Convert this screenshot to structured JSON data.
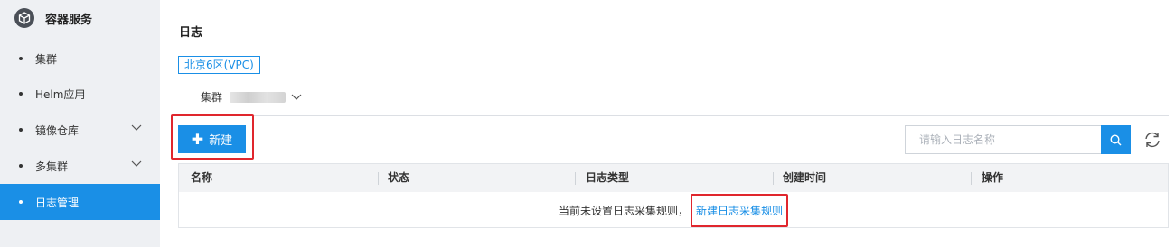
{
  "sidebar": {
    "title": "容器服务",
    "items": [
      {
        "label": "集群"
      },
      {
        "label": "Helm应用"
      },
      {
        "label": "镜像仓库"
      },
      {
        "label": "多集群"
      },
      {
        "label": "日志管理"
      }
    ]
  },
  "main": {
    "title": "日志",
    "region": "北京6区(VPC)",
    "cluster_label": "集群",
    "new_button": "新建",
    "search_placeholder": "请输入日志名称",
    "table": {
      "columns": [
        "名称",
        "状态",
        "日志类型",
        "创建时间",
        "操作"
      ],
      "empty_text": "当前未设置日志采集规则，",
      "empty_link": "新建日志采集规则"
    }
  },
  "colors": {
    "accent": "#1a8fe6",
    "highlight": "#e0262d",
    "sidebar_bg": "#eef0f3"
  },
  "icons": {
    "logo": "cube-icon",
    "search": "search-icon",
    "refresh": "refresh-icon",
    "chevron": "chevron-down-icon",
    "add": "plus-icon"
  }
}
